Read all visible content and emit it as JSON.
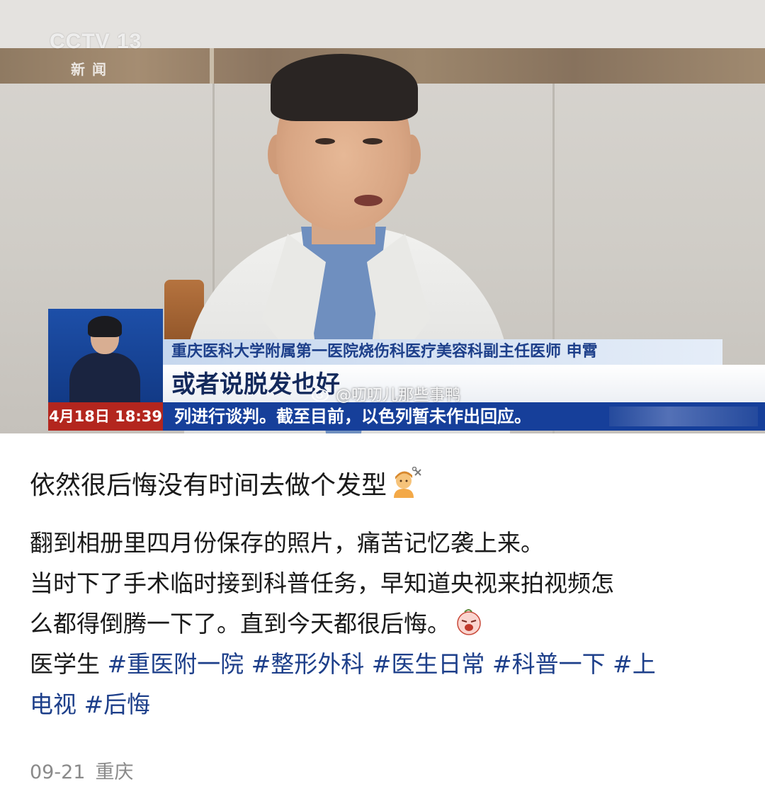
{
  "video": {
    "channel_logo": "CCTV 13",
    "channel_sub": "新闻",
    "name_caption": "重庆医科大学附属第一医院烧伤科医疗美容科副主任医师 申霄",
    "quote_caption": "或者说脱发也好",
    "ticker_time": "4月18日 18:39",
    "ticker_text": "列进行谈判。截至目前，以色列暂未作出回应。",
    "watermark": "@叨叨儿那些事鸭"
  },
  "post": {
    "title": "依然很后悔没有时间去做个发型",
    "title_emoji": "person-getting-haircut-emoji",
    "body_line_1": "翻到相册里四月份保存的照片，痛苦记忆袭上来。",
    "body_line_2": "当时下了手术临时接到科普任务，早知道央视来拍视频怎",
    "body_line_3": "么都得倒腾一下了。直到今天都很后悔。",
    "body_emoji": "crying-face-emoji",
    "tags_prefix": "医学生 ",
    "tags_line_1": "#重医附一院 #整形外科 #医生日常 #科普一下 #上",
    "tags_line_2": "电视 #后悔"
  },
  "meta": {
    "date": "09-21",
    "location": "重庆"
  }
}
